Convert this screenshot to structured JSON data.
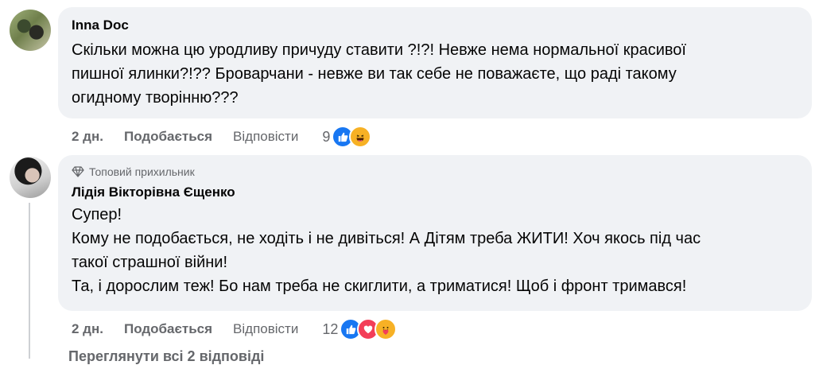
{
  "comments": [
    {
      "author": "Inna Doc",
      "text": "Скільки можна цю уродливу причуду ставити ?!?! Невже нема нормальної красивої\nпишної ялинки?!?? Броварчани - невже ви так себе не поважаєте, що раді такому\nогидному творінню???",
      "time": "2 дн.",
      "like_label": "Подобається",
      "reply_label": "Відповісти",
      "reaction_count": "9",
      "reactions": [
        "like-icon",
        "haha-icon"
      ]
    },
    {
      "badge": "Топовий прихильник",
      "author": "Лідія Вікторівна Єщенко",
      "text": "Супер!\nКому не подобається, не ходіть і не дивіться! А Дітям треба ЖИТИ! Хоч якось під час\nтакої страшної війни!\nТа, і дорослим теж! Бо нам треба не скиглити, а триматися! Щоб і фронт тримався!",
      "time": "2 дн.",
      "like_label": "Подобається",
      "reply_label": "Відповісти",
      "reaction_count": "12",
      "reactions": [
        "like-icon",
        "love-icon",
        "care-icon"
      ]
    }
  ],
  "more_replies": "Переглянути всі 2 відповіді",
  "colors": {
    "bubble": "#f0f2f5",
    "meta_text": "#65676b",
    "like": "#1877f2",
    "love": "#f33e58",
    "haha": "#f7b125"
  }
}
